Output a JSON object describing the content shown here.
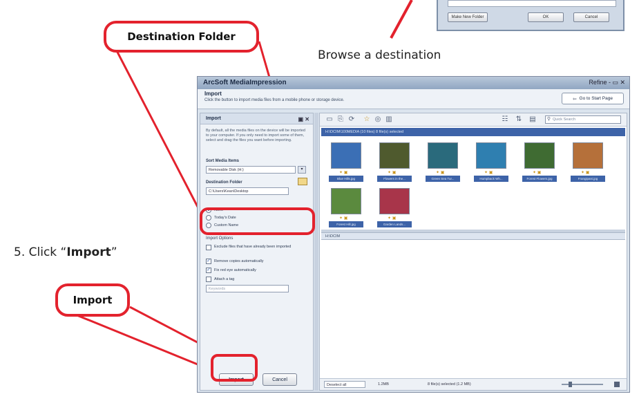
{
  "annotations": {
    "destination_callout": "Destination Folder",
    "browse_caption": "Browse a destination",
    "step_prefix": "5. Click “",
    "step_bold": "Import",
    "step_suffix": "”",
    "import_callout": "Import",
    "accent_color": "#e3222d"
  },
  "dialog_fragment": {
    "field_text": "",
    "make_folder_label": "Make New Folder",
    "ok_label": "OK",
    "cancel_label": "Cancel"
  },
  "window": {
    "title": "ArcSoft MediaImpression",
    "controls": "Refine  -  ▭  ✕",
    "header_title": "Import",
    "header_subtitle": "Click the button to import media files from a mobile phone or storage device.",
    "go_button": "Go to Start Page"
  },
  "import_panel": {
    "title": "Import",
    "description": "By default, all the media files on the device will be imported to your computer. If you only need to import some of them, select and drag the files you want before importing.",
    "sort_label": "Sort Media Items",
    "sort_value": "Removable Disk (H:)",
    "destination_label": "Destination Folder",
    "destination_value": "C:\\Users\\Kean\\Desktop",
    "radio_options": [
      "None",
      "Today's Date",
      "Custom Name"
    ],
    "import_options_label": "Import Options",
    "checkboxes": [
      {
        "label": "Exclude files that have already been imported",
        "checked": false
      },
      {
        "label": "Remove copies automatically",
        "checked": true
      },
      {
        "label": "Fix red eye automatically",
        "checked": true
      },
      {
        "label": "Attach a tag",
        "checked": false
      }
    ],
    "tag_placeholder": "Keywords",
    "import_button": "Import",
    "cancel_button": "Cancel"
  },
  "browser": {
    "search_placeholder": "Quick Search",
    "path_top": "H:\\DCIM\\100MEDIA  (10 files)        8 file(s) selected",
    "thumbnails": [
      {
        "label": "Blue Hills.jpg",
        "color": "#3b6fb5"
      },
      {
        "label": "Flowers in the...",
        "color": "#4f5a2e"
      },
      {
        "label": "Green Sea Tur...",
        "color": "#2a6a7c"
      },
      {
        "label": "Humpback Wh...",
        "color": "#2f7fb0"
      },
      {
        "label": "Forest Flowers.jpg",
        "color": "#3f6b32"
      },
      {
        "label": "Frangipani.jpg",
        "color": "#b5703a"
      },
      {
        "label": "Forest Hill.jpg",
        "color": "#5b8a3e"
      },
      {
        "label": "Garden Lands...",
        "color": "#a8354a"
      }
    ],
    "path_bottom": "H:\\DCIM",
    "status_left": "Deselect all",
    "status_count": "1.2MB",
    "status_selected": "8 file(s) selected (1.2 MB)"
  }
}
